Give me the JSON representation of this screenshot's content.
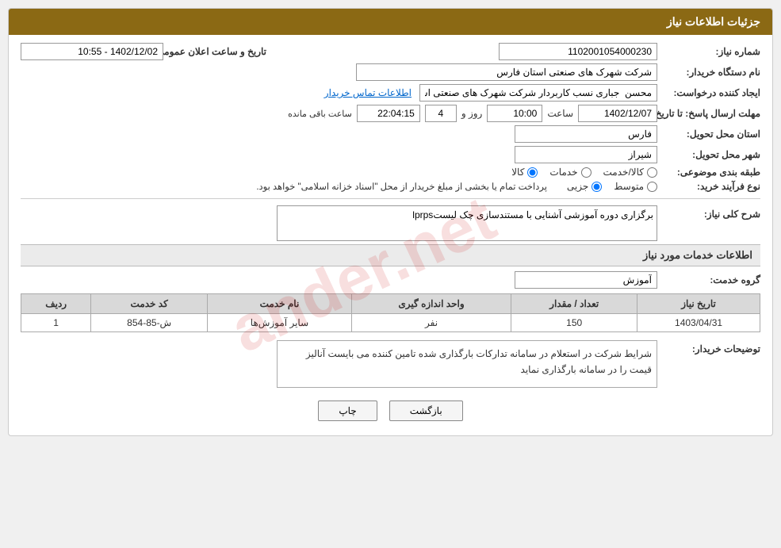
{
  "page": {
    "header": "جزئیات اطلاعات نیاز",
    "fields": {
      "need_number_label": "شماره نیاز:",
      "need_number_value": "1102001054000230",
      "org_name_label": "نام دستگاه خریدار:",
      "org_name_value": "شرکت شهرک های صنعتی استان فارس",
      "creator_label": "ایجاد کننده درخواست:",
      "creator_value": "محسن  جباری نسب کاربردار شرکت شهرک های صنعتی استان فارس",
      "contact_link": "اطلاعات تماس خریدار",
      "deadline_label": "مهلت ارسال پاسخ: تا تاریخ:",
      "deadline_date": "1402/12/07",
      "deadline_time_label": "ساعت",
      "deadline_time": "10:00",
      "deadline_days_label": "روز و",
      "deadline_days": "4",
      "deadline_remaining_label": "ساعت باقی مانده",
      "deadline_remaining": "22:04:15",
      "province_label": "استان محل تحویل:",
      "province_value": "فارس",
      "city_label": "شهر محل تحویل:",
      "city_value": "شیراز",
      "category_label": "طبقه بندی موضوعی:",
      "category_kala": "کالا",
      "category_khadamat": "خدمات",
      "category_kala_khadamat": "کالا/خدمت",
      "process_label": "نوع فرآیند خرید:",
      "process_jozee": "جزیی",
      "process_motavassett": "متوسط",
      "process_note": "پرداخت تمام یا بخشی از مبلغ خریدار از محل \"اسناد خزانه اسلامی\" خواهد بود.",
      "need_summary_title": "شرح کلی نیاز:",
      "need_summary_value": "برگزاری دوره آموزشی آشنایی با مستندسازی چک لیستlprps",
      "services_title": "اطلاعات خدمات مورد نیاز",
      "service_group_label": "گروه خدمت:",
      "service_group_value": "آموزش",
      "table_headers": [
        "ردیف",
        "کد خدمت",
        "نام خدمت",
        "واحد اندازه گیری",
        "تعداد / مقدار",
        "تاریخ نیاز"
      ],
      "table_rows": [
        {
          "row": "1",
          "service_code": "ش-85-854",
          "service_name": "سایر آموزش‌ها",
          "unit": "نفر",
          "quantity": "150",
          "date": "1403/04/31"
        }
      ],
      "buyer_desc_label": "توضیحات خریدار:",
      "buyer_desc_value": "شرایط شرکت در استعلام در سامانه تدارکات بارگذاری شده\nتامین کننده می بایست آنالیز قیمت را در سامانه بارگذاری نماید",
      "btn_back": "بازگشت",
      "btn_print": "چاپ",
      "announcement_date_label": "تاریخ و ساعت اعلان عمومی:",
      "announcement_date_value": "1402/12/02 - 10:55"
    }
  }
}
